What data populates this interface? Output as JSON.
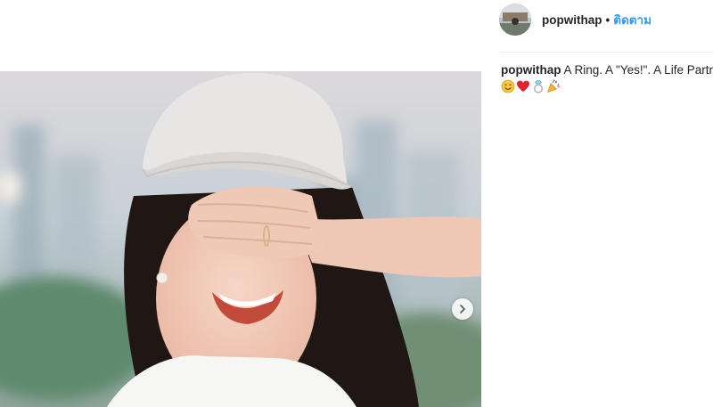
{
  "post": {
    "username": "popwithap",
    "separator": "•",
    "follow_label": "ติดตาม",
    "caption_user": "popwithap",
    "caption_text": "A Ring. A \"Yes!\". A Life Partner",
    "emojis": [
      "smiling-face-emoji",
      "red-heart-emoji",
      "ring-emoji",
      "party-popper-emoji"
    ]
  },
  "carousel": {
    "next_icon": "chevron-right-icon"
  },
  "colors": {
    "text": "#262626",
    "link": "#3897f0",
    "divider": "#efefef"
  }
}
